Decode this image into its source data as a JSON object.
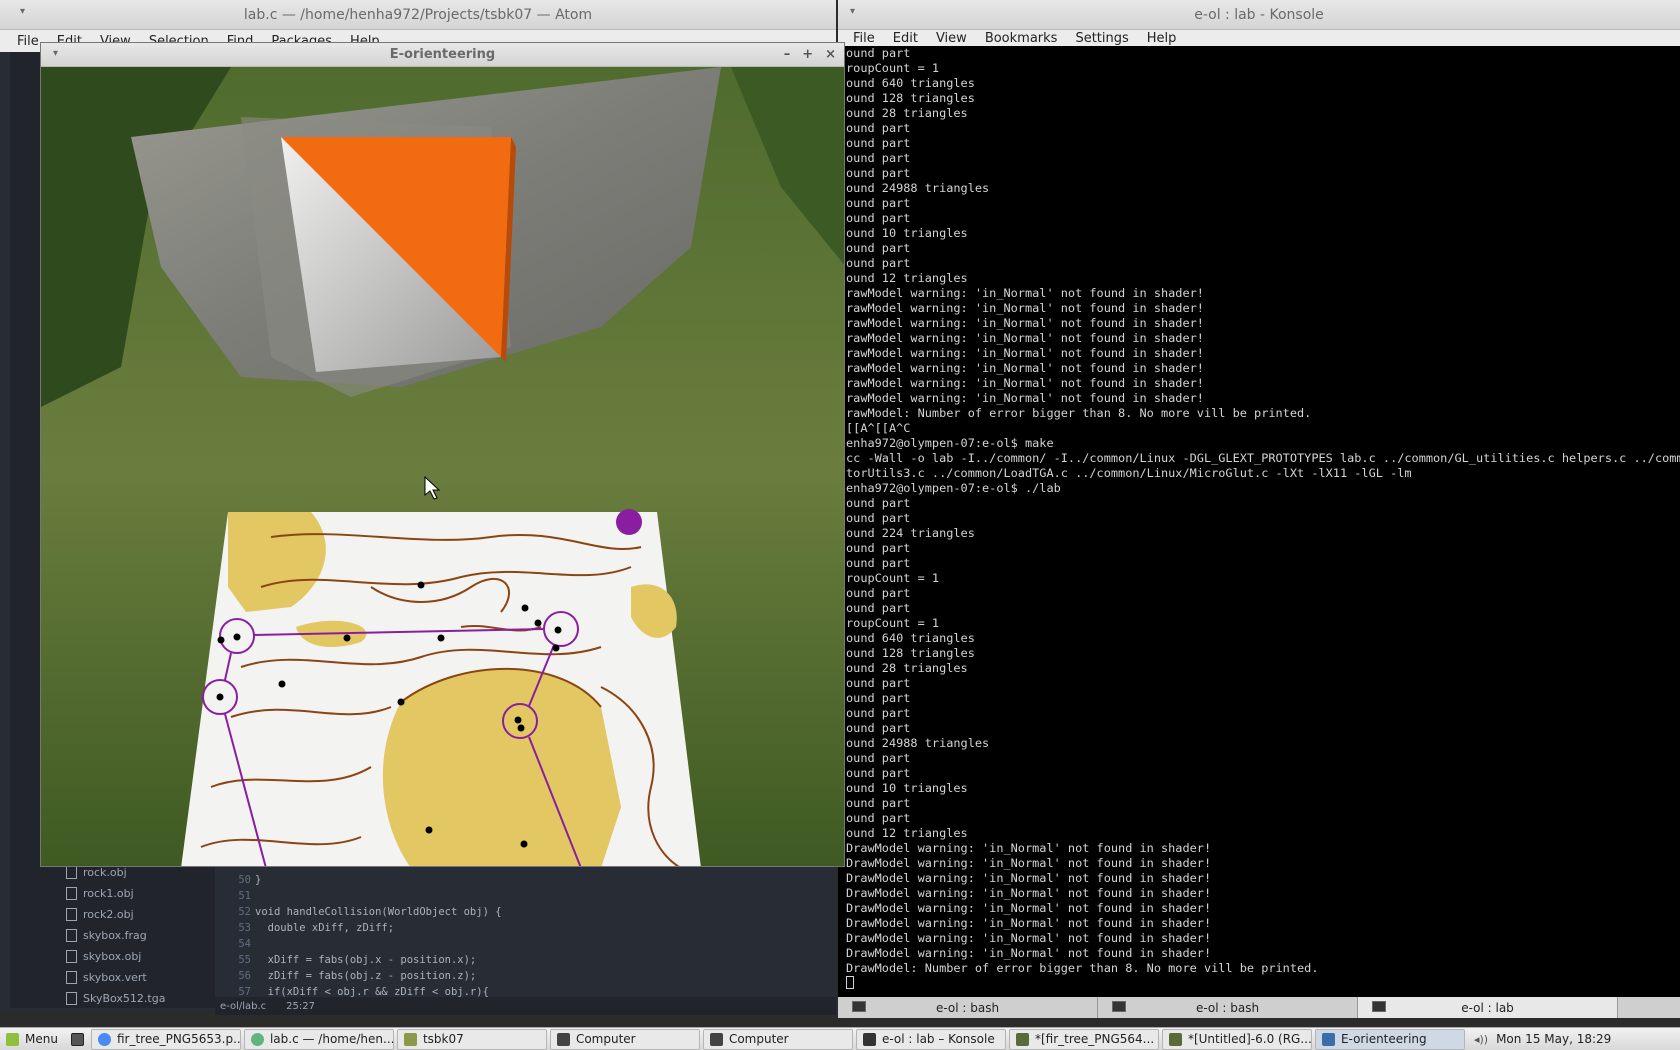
{
  "atom": {
    "title": "lab.c — /home/henha972/Projects/tsbk07 — Atom",
    "menu": [
      "File",
      "Edit",
      "View",
      "Selection",
      "Find",
      "Packages",
      "Help"
    ],
    "tree": [
      "rock.obj",
      "rock1.obj",
      "rock2.obj",
      "skybox.frag",
      "skybox.obj",
      "skybox.vert",
      "SkyBox512.tga"
    ],
    "status": {
      "path": "e-ol/lab.c",
      "cursor": "25:27"
    },
    "code": [
      {
        "n": "50",
        "t": "}"
      },
      {
        "n": "51",
        "t": ""
      },
      {
        "n": "52",
        "t": "void handleCollision(WorldObject obj) {"
      },
      {
        "n": "53",
        "t": "  double xDiff, zDiff;"
      },
      {
        "n": "54",
        "t": ""
      },
      {
        "n": "55",
        "t": "  xDiff = fabs(obj.x - position.x);"
      },
      {
        "n": "56",
        "t": "  zDiff = fabs(obj.z - position.z);"
      },
      {
        "n": "57",
        "t": "  if(xDiff < obj.r && zDiff < obj.r){"
      }
    ]
  },
  "game": {
    "title": "E-orienteering",
    "buttons": [
      "–",
      "+",
      "×"
    ]
  },
  "konsole": {
    "title": "e-ol : lab - Konsole",
    "menu": [
      "File",
      "Edit",
      "View",
      "Bookmarks",
      "Settings",
      "Help"
    ],
    "lines": [
      "ound part",
      "roupCount = 1",
      "ound 640 triangles",
      "ound 128 triangles",
      "ound 28 triangles",
      "ound part",
      "ound part",
      "ound part",
      "ound part",
      "ound 24988 triangles",
      "ound part",
      "ound part",
      "ound 10 triangles",
      "ound part",
      "ound part",
      "ound 12 triangles",
      "rawModel warning: 'in_Normal' not found in shader!",
      "rawModel warning: 'in_Normal' not found in shader!",
      "rawModel warning: 'in_Normal' not found in shader!",
      "rawModel warning: 'in_Normal' not found in shader!",
      "rawModel warning: 'in_Normal' not found in shader!",
      "rawModel warning: 'in_Normal' not found in shader!",
      "rawModel warning: 'in_Normal' not found in shader!",
      "rawModel warning: 'in_Normal' not found in shader!",
      "rawModel: Number of error bigger than 8. No more vill be printed.",
      "[[A^[[A^C",
      "enha972@olympen-07:e-ol$ make",
      "cc -Wall -o lab -I../common/ -I../common/Linux -DGL_GLEXT_PROTOTYPES lab.c ../common/GL_utilities.c helpers.c ../common",
      "torUtils3.c ../common/LoadTGA.c ../common/Linux/MicroGlut.c -lXt -lX11 -lGL -lm",
      "enha972@olympen-07:e-ol$ ./lab",
      "ound part",
      "ound part",
      "ound 224 triangles",
      "ound part",
      "ound part",
      "roupCount = 1",
      "ound part",
      "ound part",
      "roupCount = 1",
      "ound 640 triangles",
      "ound 128 triangles",
      "ound 28 triangles",
      "ound part",
      "ound part",
      "ound part",
      "ound part",
      "ound 24988 triangles",
      "ound part",
      "ound part",
      "ound 10 triangles",
      "ound part",
      "ound part",
      "ound 12 triangles",
      "DrawModel warning: 'in_Normal' not found in shader!",
      "DrawModel warning: 'in_Normal' not found in shader!",
      "DrawModel warning: 'in_Normal' not found in shader!",
      "DrawModel warning: 'in_Normal' not found in shader!",
      "DrawModel warning: 'in_Normal' not found in shader!",
      "DrawModel warning: 'in_Normal' not found in shader!",
      "DrawModel warning: 'in_Normal' not found in shader!",
      "DrawModel warning: 'in_Normal' not found in shader!",
      "DrawModel: Number of error bigger than 8. No more vill be printed."
    ],
    "tabs": [
      "e-ol : bash",
      "e-ol : bash",
      "e-ol : lab"
    ]
  },
  "taskbar": {
    "menu_label": "Menu",
    "items": [
      {
        "label": "fir_tree_PNG5653.p...",
        "icon": "chrome-icon",
        "color": "#4a8af4"
      },
      {
        "label": "lab.c — /home/hen...",
        "icon": "atom-icon",
        "color": "#5fb57d"
      },
      {
        "label": "tsbk07",
        "icon": "folder-icon",
        "color": "#8a9a4a"
      },
      {
        "label": "Computer",
        "icon": "computer-icon",
        "color": "#444444"
      },
      {
        "label": "Computer",
        "icon": "computer-icon",
        "color": "#444444"
      },
      {
        "label": "e-ol : lab – Konsole",
        "icon": "terminal-icon",
        "color": "#333333"
      },
      {
        "label": "*[fir_tree_PNG564...",
        "icon": "gimp-icon",
        "color": "#5a6b3a"
      },
      {
        "label": "*[Untitled]-6.0 (RG...",
        "icon": "gimp-icon",
        "color": "#5a6b3a"
      },
      {
        "label": "E-orienteering",
        "icon": "window-icon",
        "color": "#3b6ea8"
      }
    ],
    "clock": "Mon 15 May, 18:29"
  },
  "colors": {
    "orange": "#f26b10",
    "purple": "#8a1ea0",
    "contour": "#8b4513",
    "yellow": "#e2c763"
  }
}
